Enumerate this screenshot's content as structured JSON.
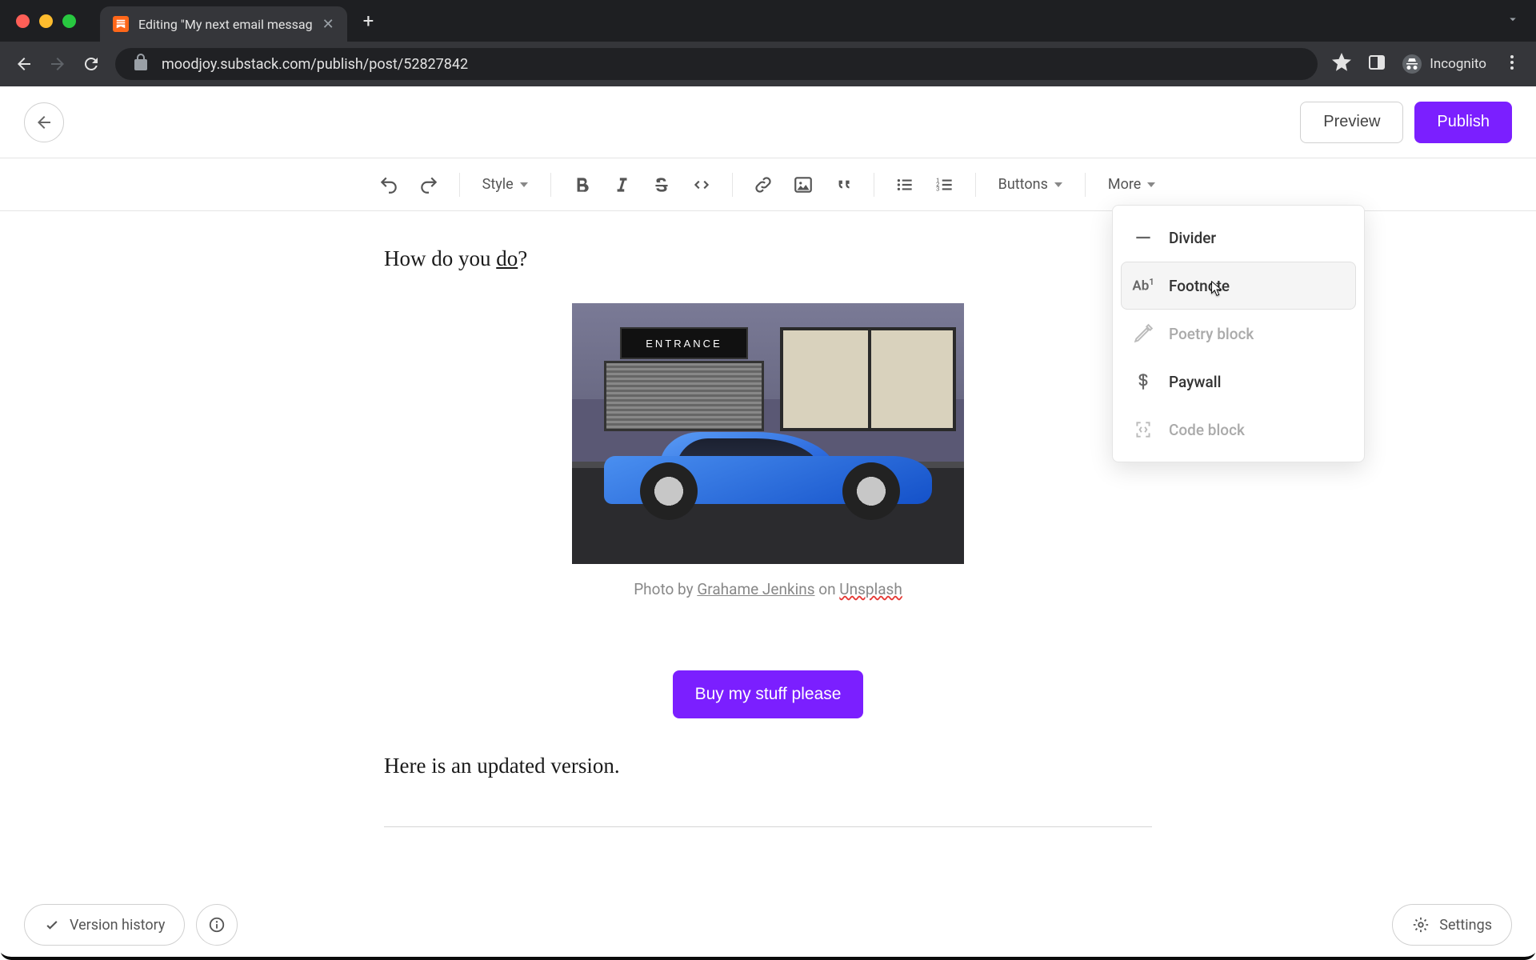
{
  "browser": {
    "tab_title": "Editing \"My next email messag",
    "url": "moodjoy.substack.com/publish/post/52827842",
    "incognito_label": "Incognito"
  },
  "header": {
    "preview_label": "Preview",
    "publish_label": "Publish"
  },
  "toolbar": {
    "style_label": "Style",
    "buttons_label": "Buttons",
    "more_label": "More"
  },
  "more_menu": {
    "items": [
      {
        "label": "Divider"
      },
      {
        "label": "Footnote"
      },
      {
        "label": "Poetry block"
      },
      {
        "label": "Paywall"
      },
      {
        "label": "Code block"
      }
    ]
  },
  "content": {
    "line1_pre": "How do you ",
    "line1_underlined": "do",
    "line1_post": "?",
    "entrance_sign": "ENTRANCE",
    "caption_pre": "Photo by ",
    "caption_author": "Grahame Jenkins",
    "caption_mid": " on ",
    "caption_source": "Unsplash",
    "cta_label": "Buy my stuff please",
    "line2": "Here is an updated version."
  },
  "footer": {
    "version_history_label": "Version history",
    "settings_label": "Settings"
  }
}
